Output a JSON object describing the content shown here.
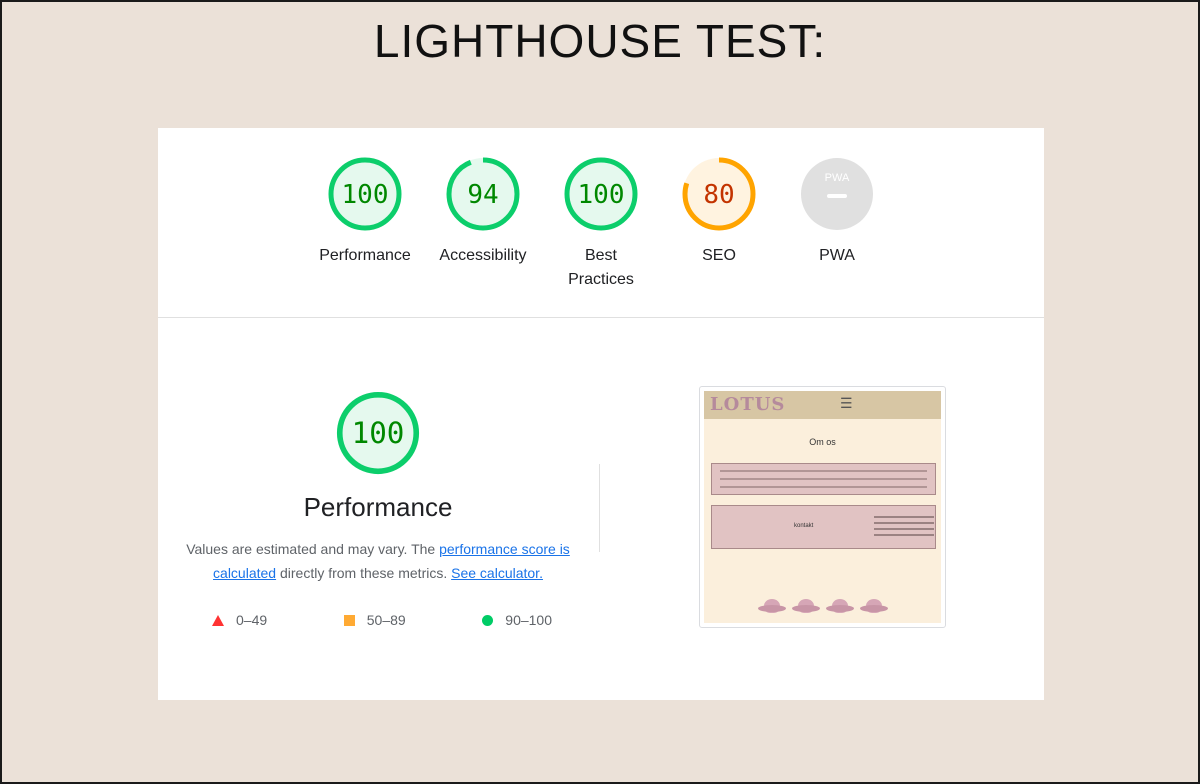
{
  "heading": "LIGHTHOUSE TEST:",
  "gauges": [
    {
      "label": "Performance",
      "score": "100",
      "value": 100,
      "status": "pass"
    },
    {
      "label": "Accessibility",
      "score": "94",
      "value": 94,
      "status": "pass"
    },
    {
      "label": "Best Practices",
      "score": "100",
      "value": 100,
      "status": "pass"
    },
    {
      "label": "SEO",
      "score": "80",
      "value": 80,
      "status": "average"
    },
    {
      "label": "PWA",
      "score": "PWA",
      "value": null,
      "status": "na"
    }
  ],
  "performance": {
    "score": "100",
    "title": "Performance",
    "desc_prefix": "Values are estimated and may vary. The ",
    "link_score": "performance score is calculated",
    "desc_middle": " directly from these metrics. ",
    "link_calculator": "See calculator."
  },
  "legend": [
    {
      "range": "0–49",
      "shape": "triangle",
      "color": "#ff3333"
    },
    {
      "range": "50–89",
      "shape": "square",
      "color": "#ffaa33"
    },
    {
      "range": "90–100",
      "shape": "circle",
      "color": "#00cc66"
    }
  ],
  "colors": {
    "pass": "#0cce6b",
    "pass_text": "#008800",
    "pass_bg": "#e5f9ee",
    "average": "#ffa400",
    "average_text": "#c33300",
    "average_bg": "#fff3e0",
    "na": "#e0e0e0",
    "na_text": "#9e9e9e"
  },
  "thumbnail": {
    "logo": "LOTUS",
    "menu_icon": "hamburger-icon",
    "title": "Om os",
    "contact_label": "kontakt"
  }
}
